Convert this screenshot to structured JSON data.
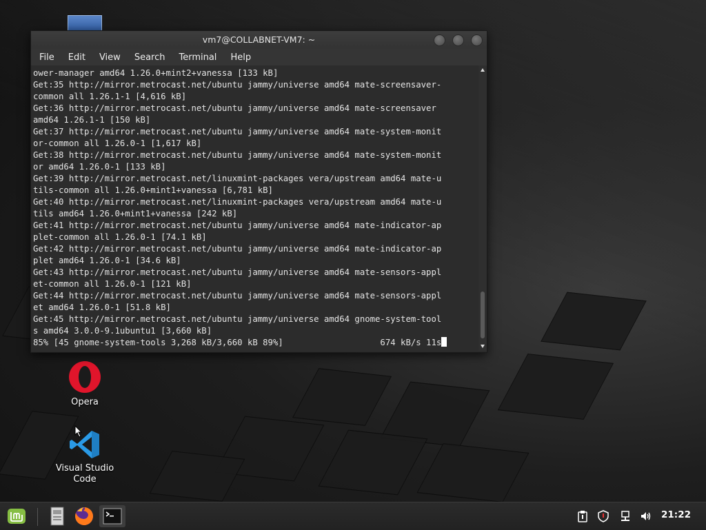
{
  "window": {
    "title": "vm7@COLLABNET-VM7: ~",
    "menu": [
      "File",
      "Edit",
      "View",
      "Search",
      "Terminal",
      "Help"
    ]
  },
  "terminal": {
    "lines": [
      "ower-manager amd64 1.26.0+mint2+vanessa [133 kB]",
      "Get:35 http://mirror.metrocast.net/ubuntu jammy/universe amd64 mate-screensaver-",
      "common all 1.26.1-1 [4,616 kB]",
      "Get:36 http://mirror.metrocast.net/ubuntu jammy/universe amd64 mate-screensaver",
      "amd64 1.26.1-1 [150 kB]",
      "Get:37 http://mirror.metrocast.net/ubuntu jammy/universe amd64 mate-system-monit",
      "or-common all 1.26.0-1 [1,617 kB]",
      "Get:38 http://mirror.metrocast.net/ubuntu jammy/universe amd64 mate-system-monit",
      "or amd64 1.26.0-1 [133 kB]",
      "Get:39 http://mirror.metrocast.net/linuxmint-packages vera/upstream amd64 mate-u",
      "tils-common all 1.26.0+mint1+vanessa [6,781 kB]",
      "Get:40 http://mirror.metrocast.net/linuxmint-packages vera/upstream amd64 mate-u",
      "tils amd64 1.26.0+mint1+vanessa [242 kB]",
      "Get:41 http://mirror.metrocast.net/ubuntu jammy/universe amd64 mate-indicator-ap",
      "plet-common all 1.26.0-1 [74.1 kB]",
      "Get:42 http://mirror.metrocast.net/ubuntu jammy/universe amd64 mate-indicator-ap",
      "plet amd64 1.26.0-1 [34.6 kB]",
      "Get:43 http://mirror.metrocast.net/ubuntu jammy/universe amd64 mate-sensors-appl",
      "et-common all 1.26.0-1 [121 kB]",
      "Get:44 http://mirror.metrocast.net/ubuntu jammy/universe amd64 mate-sensors-appl",
      "et amd64 1.26.0-1 [51.8 kB]",
      "Get:45 http://mirror.metrocast.net/ubuntu jammy/universe amd64 gnome-system-tool",
      "s amd64 3.0.0-9.1ubuntu1 [3,660 kB]"
    ],
    "progress_line": "85% [45 gnome-system-tools 3,268 kB/3,660 kB 89%]",
    "rate": "674 kB/s 11s"
  },
  "desktop": {
    "icons": [
      {
        "label": "Opera",
        "icon": "opera-icon"
      },
      {
        "label": "Visual Studio Code",
        "icon": "vscode-icon"
      }
    ]
  },
  "taskbar": {
    "clock": "21:22",
    "launchers": [
      "mint-menu-icon",
      "file-manager-icon",
      "firefox-icon",
      "terminal-icon"
    ],
    "tray": [
      "clipboard-icon",
      "shield-icon",
      "network-icon",
      "volume-icon"
    ]
  },
  "colors": {
    "opera_red": "#e0152b",
    "vscode_blue": "#2a9ae6",
    "mint_green": "#86be43"
  }
}
